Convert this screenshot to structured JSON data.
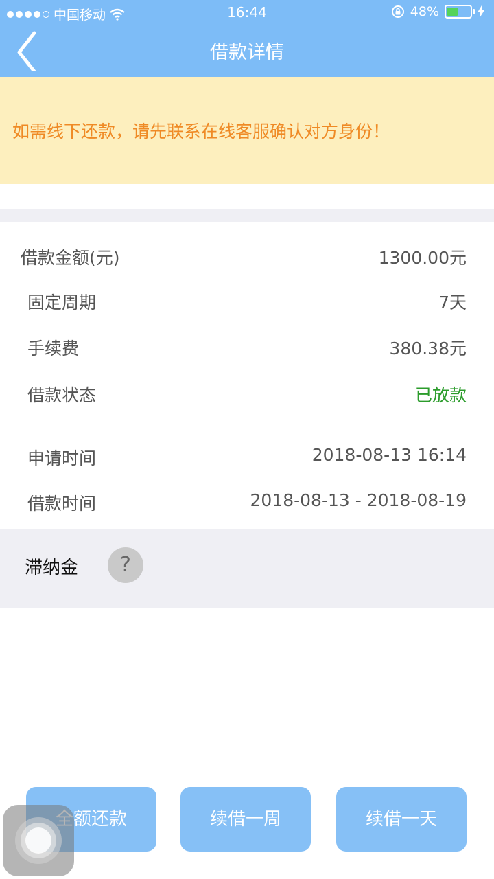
{
  "status": {
    "carrier": "中国移动",
    "time": "16:44",
    "battery": "48%",
    "battery_level": 0.48
  },
  "nav": {
    "title": "借款详情"
  },
  "notice": {
    "text": "如需线下还款，请先联系在线客服确认对方身份！"
  },
  "details": {
    "amount_label": "借款金额(元)",
    "amount_value": "1300.00元",
    "period_label": "固定周期",
    "period_value": "7天",
    "fee_label": "手续费",
    "fee_value": "380.38元",
    "status_label": "借款状态",
    "status_value": "已放款",
    "apply_time_label": "申请时间",
    "apply_time_value": "2018-08-13 16:14",
    "loan_time_label": "借款时间",
    "loan_time_value": "2018-08-13 - 2018-08-19"
  },
  "late_fee": {
    "label": "滞纳金",
    "help": "?"
  },
  "buttons": {
    "repay_all": "全额还款",
    "renew_week": "续借一周",
    "renew_day": "续借一天"
  },
  "colors": {
    "header": "#7dbcf7",
    "notice_bg": "#fdefbe",
    "notice_text": "#ef8a25",
    "status_green": "#2c9c2c",
    "button": "#86c0f6"
  }
}
